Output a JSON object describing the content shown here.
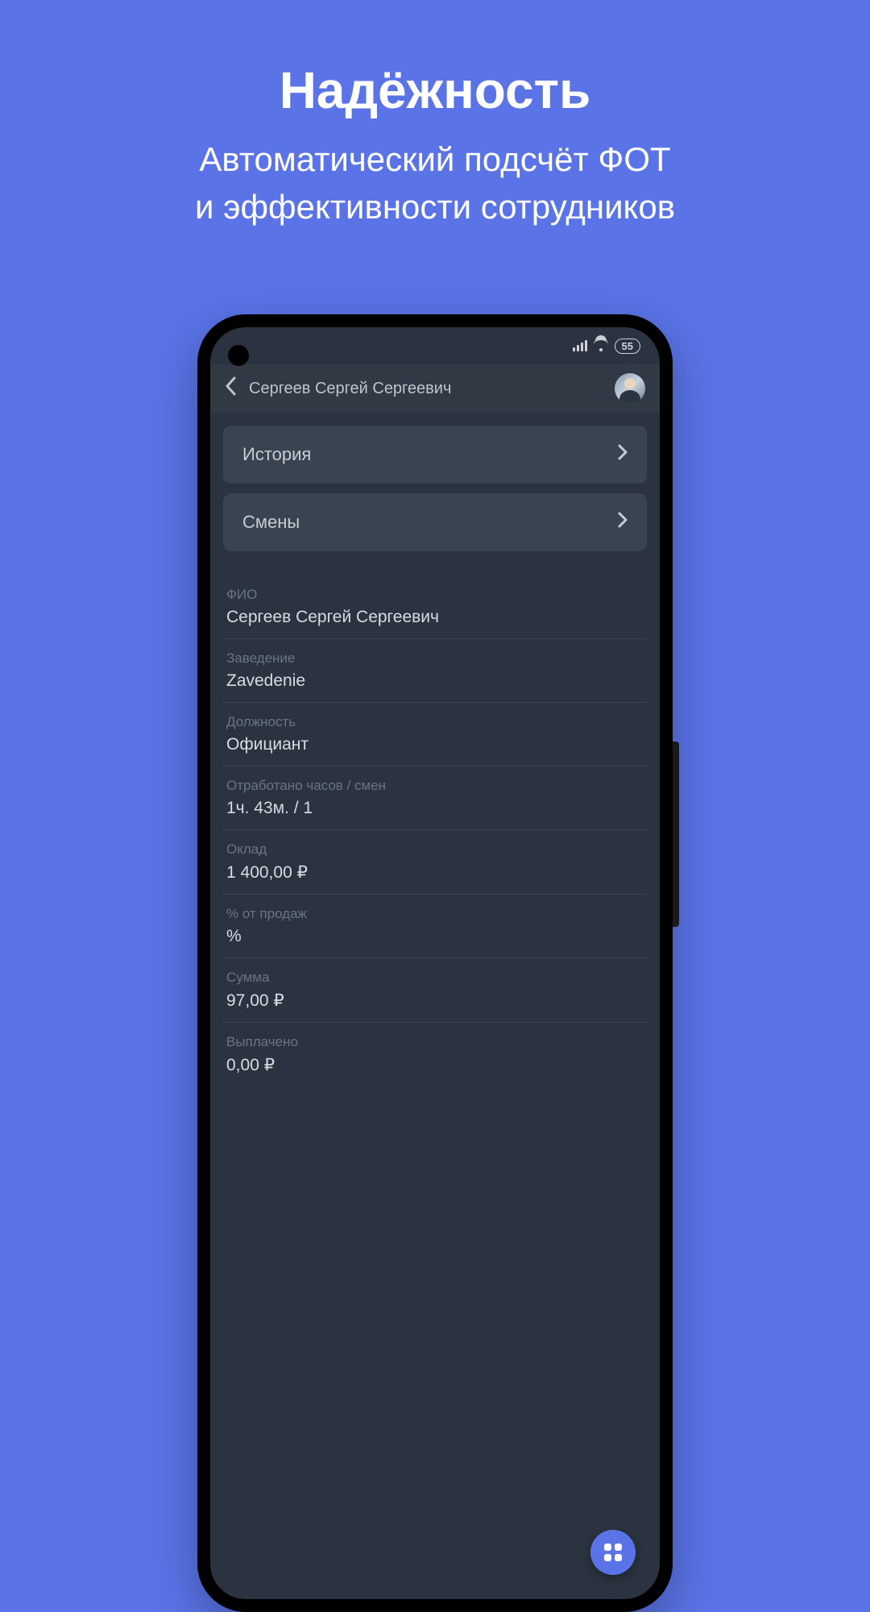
{
  "promo": {
    "title": "Надёжность",
    "subtitle_line1": "Автоматический подсчёт ФОТ",
    "subtitle_line2": "и эффективности сотрудников"
  },
  "status_bar": {
    "battery": "55"
  },
  "header": {
    "title": "Сергеев Сергей Сергеевич"
  },
  "nav_cards": [
    {
      "label": "История"
    },
    {
      "label": "Смены"
    }
  ],
  "info_rows": [
    {
      "label": "ФИО",
      "value": "Сергеев Сергей Сергеевич"
    },
    {
      "label": "Заведение",
      "value": "Zavedenie"
    },
    {
      "label": "Должность",
      "value": "Официант"
    },
    {
      "label": "Отработано часов / смен",
      "value": "1ч. 43м. / 1"
    },
    {
      "label": "Оклад",
      "value": "1 400,00 ₽"
    },
    {
      "label": "% от продаж",
      "value": "%"
    },
    {
      "label": "Сумма",
      "value": "97,00 ₽"
    },
    {
      "label": "Выплачено",
      "value": "0,00 ₽"
    }
  ]
}
